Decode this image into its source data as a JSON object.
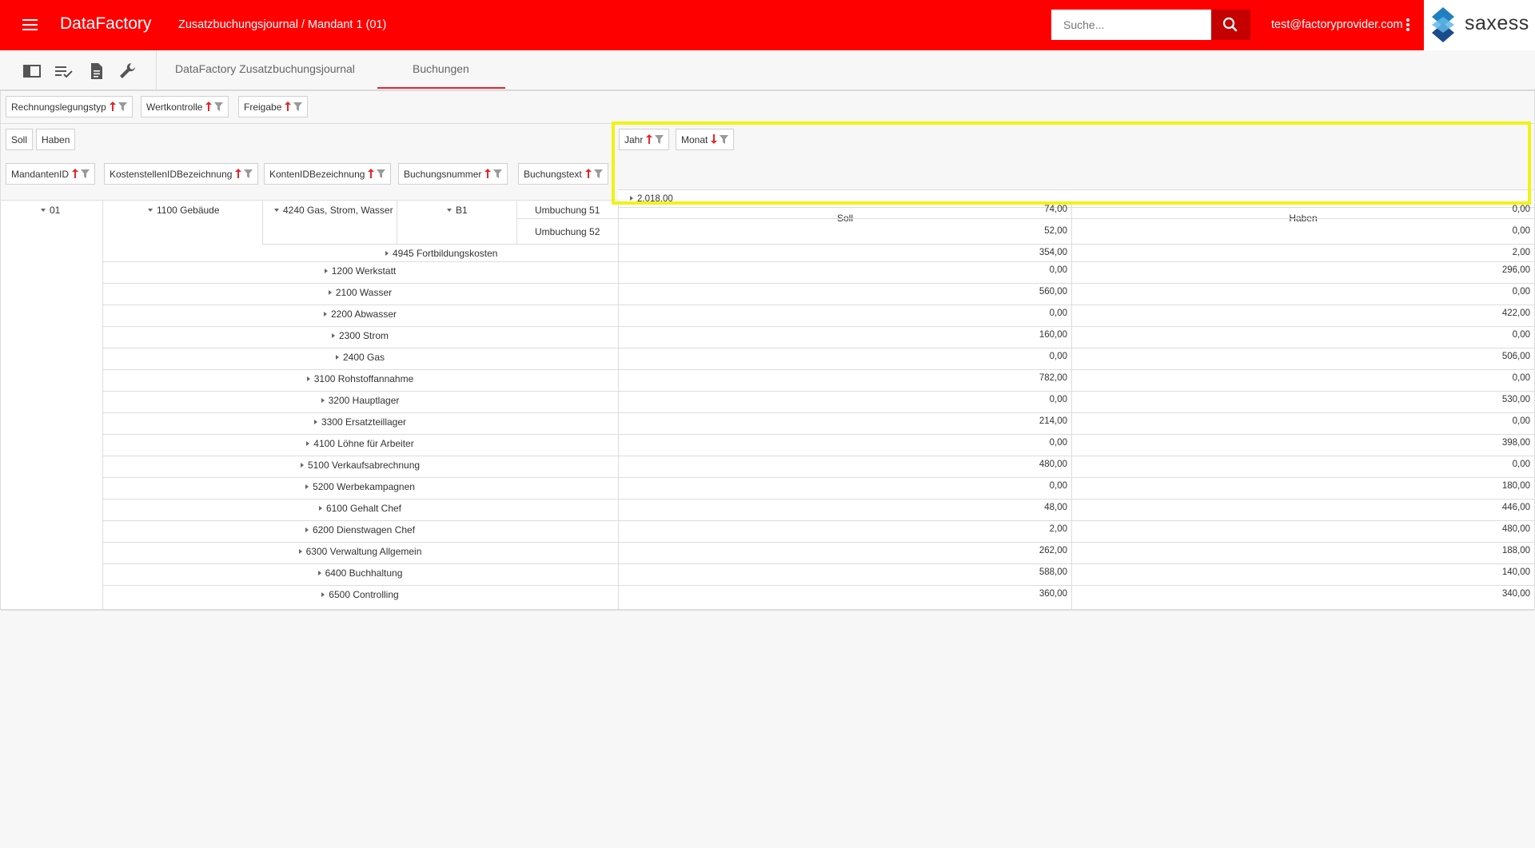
{
  "header": {
    "app_title": "DataFactory",
    "breadcrumb": "Zusatzbuchungsjournal / Mandant 1 (01)",
    "search_placeholder": "Suche...",
    "user_email": "test@factoryprovider.com",
    "logo_text": "saxess",
    "brand_color": "#ff0000"
  },
  "tabs": [
    {
      "label": "DataFactory Zusatzbuchungsjournal",
      "active": false
    },
    {
      "label": "Buchungen",
      "active": true
    }
  ],
  "filter_fields": [
    {
      "label": "Rechnungslegungstyp",
      "sort": "asc"
    },
    {
      "label": "Wertkontrolle",
      "sort": "asc"
    },
    {
      "label": "Freigabe",
      "sort": "asc"
    }
  ],
  "data_fields": [
    "Soll",
    "Haben"
  ],
  "column_fields": [
    {
      "label": "Jahr",
      "sort": "asc"
    },
    {
      "label": "Monat",
      "sort": "desc"
    }
  ],
  "row_fields": [
    {
      "label": "MandantenID",
      "sort": "asc"
    },
    {
      "label": "KostenstellenIDBezeichnung",
      "sort": "asc"
    },
    {
      "label": "KontenIDBezeichnung",
      "sort": "asc"
    },
    {
      "label": "Buchungsnummer",
      "sort": "asc"
    },
    {
      "label": "Buchungstext",
      "sort": "asc"
    }
  ],
  "year_value": "2.018,00",
  "measure_headers": [
    "Soll",
    "Haben"
  ],
  "tree": {
    "mandant": "01",
    "kostenstelle": "1100 Gebäude",
    "konto": "4240 Gas, Strom, Wasser",
    "buchungsnummer": "B1",
    "buchungen": [
      {
        "text": "Umbuchung 51",
        "soll": "74,00",
        "haben": "0,00"
      },
      {
        "text": "Umbuchung 52",
        "soll": "52,00",
        "haben": "0,00"
      }
    ],
    "konto2": {
      "label": "4945 Fortbildungskosten",
      "soll": "354,00",
      "haben": "2,00"
    }
  },
  "rows": [
    {
      "label": "1200 Werkstatt",
      "soll": "0,00",
      "haben": "296,00"
    },
    {
      "label": "2100 Wasser",
      "soll": "560,00",
      "haben": "0,00"
    },
    {
      "label": "2200 Abwasser",
      "soll": "0,00",
      "haben": "422,00"
    },
    {
      "label": "2300 Strom",
      "soll": "160,00",
      "haben": "0,00"
    },
    {
      "label": "2400 Gas",
      "soll": "0,00",
      "haben": "506,00"
    },
    {
      "label": "3100 Rohstoffannahme",
      "soll": "782,00",
      "haben": "0,00"
    },
    {
      "label": "3200 Hauptlager",
      "soll": "0,00",
      "haben": "530,00"
    },
    {
      "label": "3300 Ersatzteillager",
      "soll": "214,00",
      "haben": "0,00"
    },
    {
      "label": "4100 Löhne für Arbeiter",
      "soll": "0,00",
      "haben": "398,00"
    },
    {
      "label": "5100 Verkaufsabrechnung",
      "soll": "480,00",
      "haben": "0,00"
    },
    {
      "label": "5200 Werbekampagnen",
      "soll": "0,00",
      "haben": "180,00"
    },
    {
      "label": "6100 Gehalt Chef",
      "soll": "48,00",
      "haben": "446,00"
    },
    {
      "label": "6200 Dienstwagen Chef",
      "soll": "2,00",
      "haben": "480,00"
    },
    {
      "label": "6300 Verwaltung Allgemein",
      "soll": "262,00",
      "haben": "188,00"
    },
    {
      "label": "6400 Buchhaltung",
      "soll": "588,00",
      "haben": "140,00"
    },
    {
      "label": "6500 Controlling",
      "soll": "360,00",
      "haben": "340,00"
    }
  ]
}
